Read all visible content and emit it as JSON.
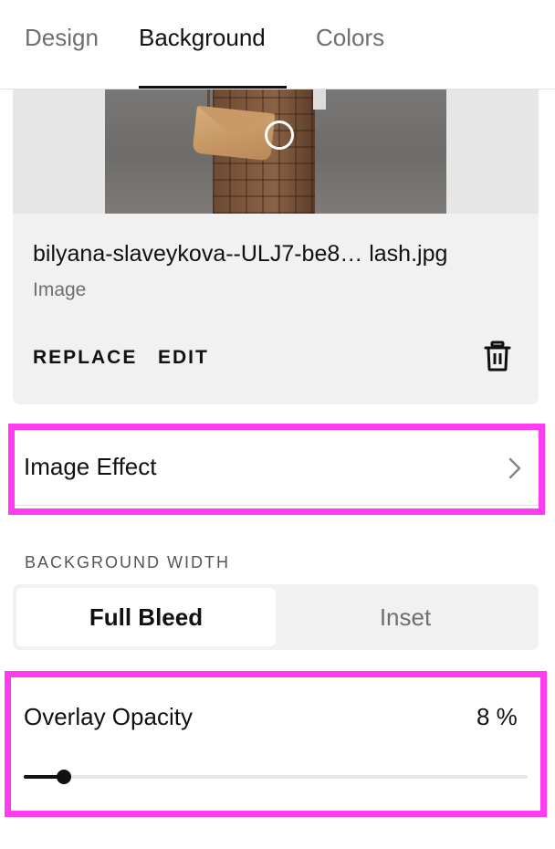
{
  "tabs": [
    {
      "label": "Design",
      "active": false
    },
    {
      "label": "Background",
      "active": true
    },
    {
      "label": "Colors",
      "active": false
    }
  ],
  "image": {
    "file_name": "bilyana-slaveykova--ULJ7-be8…  lash.jpg",
    "type_label": "Image",
    "replace_label": "REPLACE",
    "edit_label": "EDIT",
    "delete_icon": "trash-icon"
  },
  "image_effect": {
    "label": "Image Effect",
    "icon": "chevron-right-icon"
  },
  "background_width": {
    "label": "BACKGROUND WIDTH",
    "options": [
      "Full Bleed",
      "Inset"
    ],
    "selected": "Full Bleed"
  },
  "overlay_opacity": {
    "label": "Overlay Opacity",
    "value_text": "8 %",
    "value": 8
  },
  "colors": {
    "highlight": "#ff3cf0",
    "text": "#111111",
    "muted": "#6f6f6f",
    "panel": "#f1f1f1"
  }
}
